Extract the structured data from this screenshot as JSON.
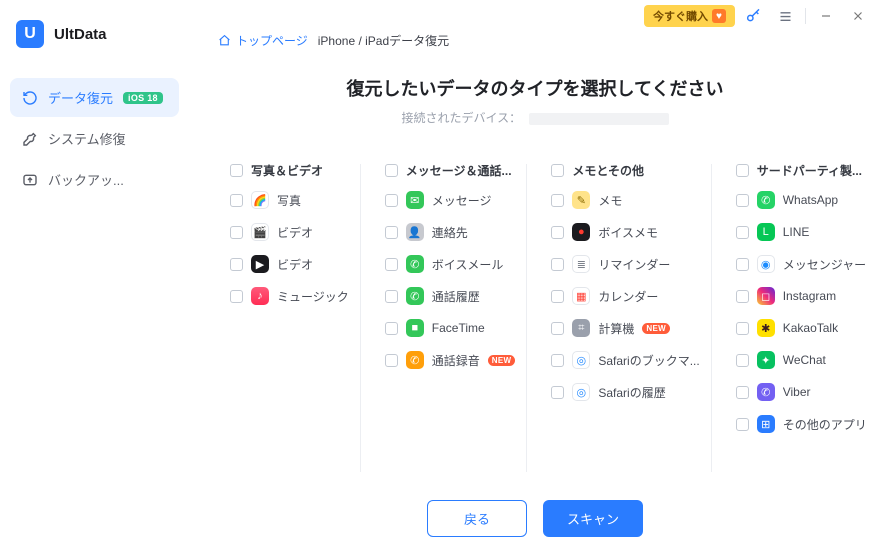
{
  "app": {
    "name": "UltData"
  },
  "titlebar": {
    "buy_label": "今すぐ購入"
  },
  "sidebar": {
    "items": [
      {
        "key": "recover",
        "label": "データ復元",
        "badge": "iOS 18",
        "active": true
      },
      {
        "key": "repair",
        "label": "システム修復"
      },
      {
        "key": "backup",
        "label": "バックアッ..."
      }
    ]
  },
  "breadcrumb": {
    "home": "トップページ",
    "current": "iPhone / iPadデータ復元"
  },
  "header": {
    "title": "復元したいデータのタイプを選択してください",
    "device_prefix": "接続されたデバイス："
  },
  "columns": [
    {
      "key": "media",
      "heading": "写真＆ビデオ",
      "items": [
        {
          "key": "photos",
          "label": "写真",
          "icon": {
            "bg": "#ffffff",
            "glyph": "🌈"
          }
        },
        {
          "key": "videos-cam",
          "label": "ビデオ",
          "icon": {
            "bg": "#ffffff",
            "glyph": "🎬"
          }
        },
        {
          "key": "videos-tv",
          "label": "ビデオ",
          "icon": {
            "bg": "#1b1b1f",
            "glyph": "▶",
            "fg": "#ffffff"
          }
        },
        {
          "key": "music",
          "label": "ミュージック",
          "icon": {
            "bg": "linear-gradient(180deg,#ff5a7a,#ff2d55)",
            "glyph": "♪",
            "fg": "#ffffff"
          }
        }
      ]
    },
    {
      "key": "messages",
      "heading": "メッセージ＆通話...",
      "items": [
        {
          "key": "messages",
          "label": "メッセージ",
          "icon": {
            "bg": "#33c759",
            "glyph": "✉",
            "fg": "#ffffff"
          }
        },
        {
          "key": "contacts",
          "label": "連絡先",
          "icon": {
            "bg": "#c7c9cf",
            "glyph": "👤",
            "fg": "#ffffff"
          }
        },
        {
          "key": "voicemail",
          "label": "ボイスメール",
          "icon": {
            "bg": "#33c759",
            "glyph": "✆",
            "fg": "#ffffff"
          }
        },
        {
          "key": "calls",
          "label": "通話履歴",
          "icon": {
            "bg": "#33c759",
            "glyph": "✆",
            "fg": "#ffffff"
          }
        },
        {
          "key": "facetime",
          "label": "FaceTime",
          "icon": {
            "bg": "#33c759",
            "glyph": "■",
            "fg": "#ffffff"
          }
        },
        {
          "key": "callrec",
          "label": "通話録音",
          "icon": {
            "bg": "#ff9f0a",
            "glyph": "✆",
            "fg": "#ffffff"
          },
          "new": true
        }
      ]
    },
    {
      "key": "notes",
      "heading": "メモとその他",
      "items": [
        {
          "key": "notes",
          "label": "メモ",
          "icon": {
            "bg": "#ffe38a",
            "glyph": "✎",
            "fg": "#8a6a00"
          }
        },
        {
          "key": "voicememo",
          "label": "ボイスメモ",
          "icon": {
            "bg": "#1b1b1f",
            "glyph": "●",
            "fg": "#ff3b30"
          }
        },
        {
          "key": "reminders",
          "label": "リマインダー",
          "icon": {
            "bg": "#ffffff",
            "glyph": "≣",
            "fg": "#7d828c"
          }
        },
        {
          "key": "calendar",
          "label": "カレンダー",
          "icon": {
            "bg": "#ffffff",
            "glyph": "▦",
            "fg": "#ff3b30"
          }
        },
        {
          "key": "calculator",
          "label": "計算機",
          "icon": {
            "bg": "#9aa0ac",
            "glyph": "⌗",
            "fg": "#ffffff"
          },
          "new": true
        },
        {
          "key": "safari-bm",
          "label": "Safariのブックマ...",
          "icon": {
            "bg": "#ffffff",
            "glyph": "◎",
            "fg": "#1f87ff"
          }
        },
        {
          "key": "safari-his",
          "label": "Safariの履歴",
          "icon": {
            "bg": "#ffffff",
            "glyph": "◎",
            "fg": "#1f87ff"
          }
        }
      ]
    },
    {
      "key": "thirdparty",
      "heading": "サードパーティ製...",
      "items": [
        {
          "key": "whatsapp",
          "label": "WhatsApp",
          "icon": {
            "bg": "#25d366",
            "glyph": "✆",
            "fg": "#ffffff"
          }
        },
        {
          "key": "line",
          "label": "LINE",
          "icon": {
            "bg": "#06c755",
            "glyph": "L",
            "fg": "#ffffff"
          }
        },
        {
          "key": "messenger",
          "label": "メッセンジャー",
          "icon": {
            "bg": "#ffffff",
            "glyph": "◉",
            "fg": "#1a8cff"
          }
        },
        {
          "key": "instagram",
          "label": "Instagram",
          "icon": {
            "bg": "linear-gradient(45deg,#f9ce34,#ee2a7b,#6228d7)",
            "glyph": "◻",
            "fg": "#ffffff"
          }
        },
        {
          "key": "kakaotalk",
          "label": "KakaoTalk",
          "icon": {
            "bg": "#ffe000",
            "glyph": "✱",
            "fg": "#3c1e1e"
          }
        },
        {
          "key": "wechat",
          "label": "WeChat",
          "icon": {
            "bg": "#07c160",
            "glyph": "✦",
            "fg": "#ffffff"
          }
        },
        {
          "key": "viber",
          "label": "Viber",
          "icon": {
            "bg": "#7360f2",
            "glyph": "✆",
            "fg": "#ffffff"
          }
        },
        {
          "key": "other",
          "label": "その他のアプリ",
          "icon": {
            "bg": "#2a7cff",
            "glyph": "⊞",
            "fg": "#ffffff"
          }
        }
      ]
    }
  ],
  "buttons": {
    "back": "戻る",
    "scan": "スキャン"
  },
  "strings": {
    "new_badge": "NEW"
  }
}
